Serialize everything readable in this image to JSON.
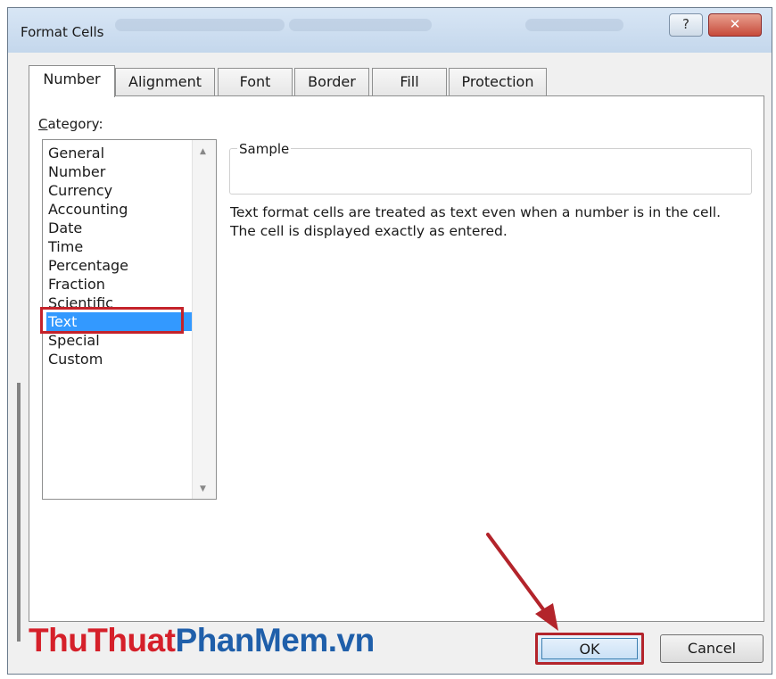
{
  "dialog": {
    "title": "Format Cells",
    "help_label": "?",
    "close_label": "✕"
  },
  "tabs": [
    {
      "label": "Number"
    },
    {
      "label": "Alignment"
    },
    {
      "label": "Font"
    },
    {
      "label": "Border"
    },
    {
      "label": "Fill"
    },
    {
      "label": "Protection"
    }
  ],
  "active_tab": "Number",
  "category": {
    "label_underlined": "C",
    "label_rest": "ategory:",
    "items": [
      {
        "label": "General"
      },
      {
        "label": "Number"
      },
      {
        "label": "Currency"
      },
      {
        "label": "Accounting"
      },
      {
        "label": "Date"
      },
      {
        "label": "Time"
      },
      {
        "label": "Percentage"
      },
      {
        "label": "Fraction"
      },
      {
        "label": "Scientific"
      },
      {
        "label": "Text"
      },
      {
        "label": "Special"
      },
      {
        "label": "Custom"
      }
    ],
    "selected": "Text",
    "scroll_up_icon": "triangle-up",
    "scroll_down_icon": "triangle-down"
  },
  "sample": {
    "legend": "Sample",
    "value": ""
  },
  "description": {
    "line1": "Text format cells are treated as text even when a number is in the cell.",
    "line2": "The cell is displayed exactly as entered."
  },
  "buttons": {
    "ok_label": "OK",
    "cancel_label": "Cancel"
  },
  "watermark": {
    "part1": "ThuThuat",
    "part2": "PhanMem.vn"
  },
  "colors": {
    "selection": "#3399ff",
    "annotation_red": "#c4222a",
    "watermark_red": "#d5202a",
    "watermark_blue": "#1f5faa"
  }
}
